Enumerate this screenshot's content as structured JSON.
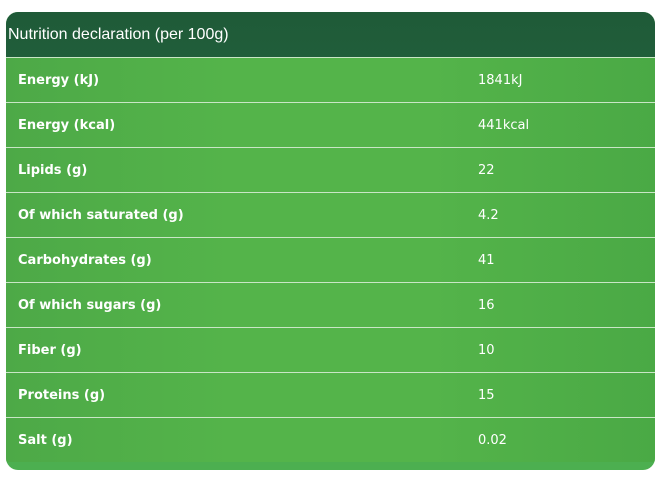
{
  "table": {
    "title": "Nutrition declaration (per 100g)",
    "rows": [
      {
        "label": "Energy (kJ)",
        "value": "1841kJ"
      },
      {
        "label": "Energy (kcal)",
        "value": "441kcal"
      },
      {
        "label": "Lipids (g)",
        "value": "22"
      },
      {
        "label": "Of which saturated (g)",
        "value": "4.2"
      },
      {
        "label": "Carbohydrates (g)",
        "value": "41"
      },
      {
        "label": "Of which sugars (g)",
        "value": "16"
      },
      {
        "label": "Fiber (g)",
        "value": "10"
      },
      {
        "label": "Proteins (g)",
        "value": "15"
      },
      {
        "label": "Salt (g)",
        "value": "0.02"
      }
    ]
  },
  "colors": {
    "header_bg": "#1f5a38",
    "row_bg": "#54b44a",
    "row_divider": "#c9e6c6",
    "text": "#ffffff"
  }
}
